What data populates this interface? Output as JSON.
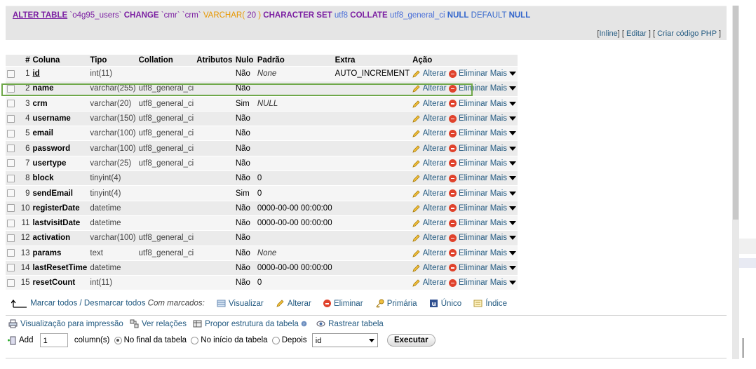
{
  "sql": {
    "alter_table": "ALTER TABLE",
    "table_name": "`o4g95_users`",
    "change": "CHANGE",
    "col_old": "`cmr`",
    "col_new": "`crm`",
    "type": "VARCHAR(",
    "len": " 20 ",
    "type_close": ")",
    "charset_kw": "CHARACTER SET",
    "charset": "utf8",
    "collate_kw": "COLLATE",
    "collate": "utf8_general_ci",
    "null_kw": "NULL",
    "default_kw": "DEFAULT",
    "default_val": "NULL",
    "links": {
      "inline": "Inline",
      "edit": "Editar",
      "php": "Criar código PHP"
    }
  },
  "headers": {
    "hash": "#",
    "column": "Coluna",
    "type": "Tipo",
    "collation": "Collation",
    "attributes": "Atributos",
    "null": "Nulo",
    "default": "Padrão",
    "extra": "Extra",
    "action": "Ação"
  },
  "actions": {
    "alter": "Alterar",
    "drop": "Eliminar",
    "more": "Mais"
  },
  "rows": [
    {
      "n": "1",
      "name": "id",
      "type": "int(11)",
      "coll": "",
      "null": "Não",
      "default": "None",
      "extra": "AUTO_INCREMENT"
    },
    {
      "n": "2",
      "name": "name",
      "type": "varchar(255)",
      "coll": "utf8_general_ci",
      "null": "Não",
      "default": "",
      "extra": ""
    },
    {
      "n": "3",
      "name": "crm",
      "type": "varchar(20)",
      "coll": "utf8_general_ci",
      "null": "Sim",
      "default": "NULL",
      "extra": ""
    },
    {
      "n": "4",
      "name": "username",
      "type": "varchar(150)",
      "coll": "utf8_general_ci",
      "null": "Não",
      "default": "",
      "extra": ""
    },
    {
      "n": "5",
      "name": "email",
      "type": "varchar(100)",
      "coll": "utf8_general_ci",
      "null": "Não",
      "default": "",
      "extra": ""
    },
    {
      "n": "6",
      "name": "password",
      "type": "varchar(100)",
      "coll": "utf8_general_ci",
      "null": "Não",
      "default": "",
      "extra": ""
    },
    {
      "n": "7",
      "name": "usertype",
      "type": "varchar(25)",
      "coll": "utf8_general_ci",
      "null": "Não",
      "default": "",
      "extra": ""
    },
    {
      "n": "8",
      "name": "block",
      "type": "tinyint(4)",
      "coll": "",
      "null": "Não",
      "default": "0",
      "extra": ""
    },
    {
      "n": "9",
      "name": "sendEmail",
      "type": "tinyint(4)",
      "coll": "",
      "null": "Sim",
      "default": "0",
      "extra": ""
    },
    {
      "n": "10",
      "name": "registerDate",
      "type": "datetime",
      "coll": "",
      "null": "Não",
      "default": "0000-00-00 00:00:00",
      "extra": ""
    },
    {
      "n": "11",
      "name": "lastvisitDate",
      "type": "datetime",
      "coll": "",
      "null": "Não",
      "default": "0000-00-00 00:00:00",
      "extra": ""
    },
    {
      "n": "12",
      "name": "activation",
      "type": "varchar(100)",
      "coll": "utf8_general_ci",
      "null": "Não",
      "default": "",
      "extra": ""
    },
    {
      "n": "13",
      "name": "params",
      "type": "text",
      "coll": "utf8_general_ci",
      "null": "Não",
      "default": "None",
      "extra": ""
    },
    {
      "n": "14",
      "name": "lastResetTime",
      "type": "datetime",
      "coll": "",
      "null": "Não",
      "default": "0000-00-00 00:00:00",
      "extra": ""
    },
    {
      "n": "15",
      "name": "resetCount",
      "type": "int(11)",
      "coll": "",
      "null": "Não",
      "default": "0",
      "extra": ""
    }
  ],
  "bulk": {
    "select_all": "Marcar todos / Desmarcar todos",
    "with_selected": "Com marcados:",
    "browse": "Visualizar",
    "change": "Alterar",
    "drop": "Eliminar",
    "primary": "Primária",
    "unique": "Único",
    "index": "Índice"
  },
  "tools": {
    "print_view": "Visualização para impressão",
    "relation_view": "Ver relações",
    "propose_structure": "Propor estrutura da tabela",
    "track_table": "Rastrear tabela"
  },
  "add": {
    "label": "Add",
    "count": "1",
    "columns": "column(s)",
    "at_end": "No final da tabela",
    "at_begin": "No início da tabela",
    "after": "Depois",
    "after_col": "id",
    "execute": "Executar"
  }
}
